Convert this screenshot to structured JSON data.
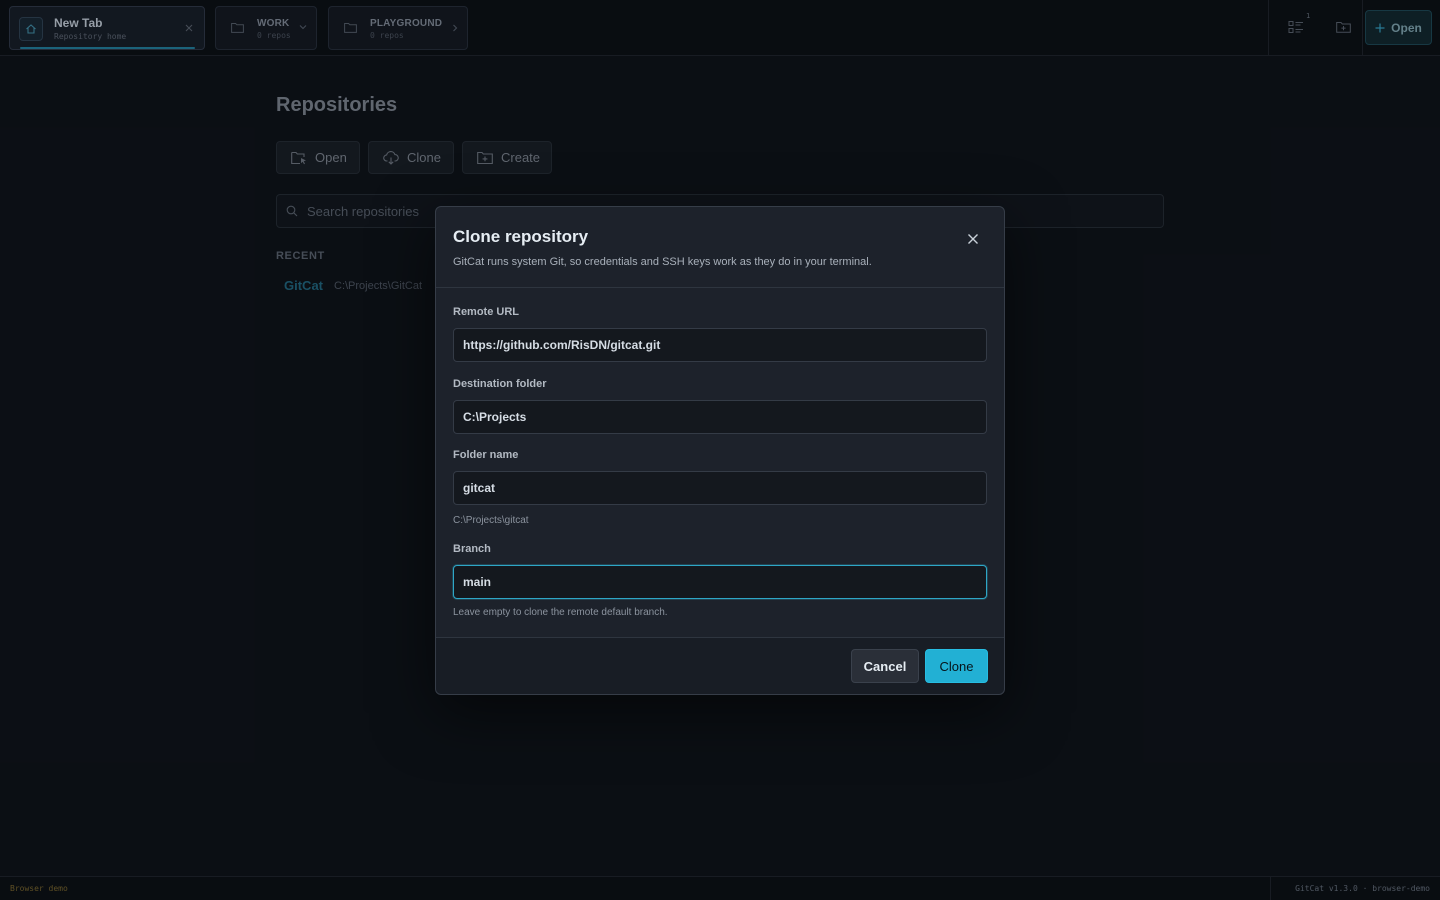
{
  "tabs": {
    "home": {
      "title": "New Tab",
      "subtitle": "Repository home"
    },
    "groups": [
      {
        "name": "WORK",
        "count": "0 repos"
      },
      {
        "name": "PLAYGROUND",
        "count": "0 repos"
      }
    ]
  },
  "toolbar": {
    "queue_count": "1",
    "open_label": "Open"
  },
  "main": {
    "title": "Repositories",
    "actions": {
      "open": "Open",
      "clone": "Clone",
      "create": "Create"
    },
    "search_placeholder": "Search repositories",
    "recent_heading": "RECENT",
    "recent": [
      {
        "name": "GitCat",
        "path": "C:\\Projects\\GitCat"
      }
    ]
  },
  "dialog": {
    "title": "Clone repository",
    "description": "GitCat runs system Git, so credentials and SSH keys work as they do in your terminal.",
    "remote_url_label": "Remote URL",
    "remote_url_value": "https://github.com/RisDN/gitcat.git",
    "destination_label": "Destination folder",
    "destination_value": "C:\\Projects",
    "folder_name_label": "Folder name",
    "folder_name_value": "gitcat",
    "resolved_path": "C:\\Projects\\gitcat",
    "branch_label": "Branch",
    "branch_value": "main",
    "branch_hint": "Leave empty to clone the remote default branch.",
    "cancel_label": "Cancel",
    "confirm_label": "Clone"
  },
  "status": {
    "left": "Browser demo",
    "right": "GitCat v1.3.0 · browser-demo"
  },
  "colors": {
    "background": "#0d1117",
    "dialog": "#1d222b",
    "accent": "#22b0d4",
    "focus_border": "#2ea6c6"
  }
}
